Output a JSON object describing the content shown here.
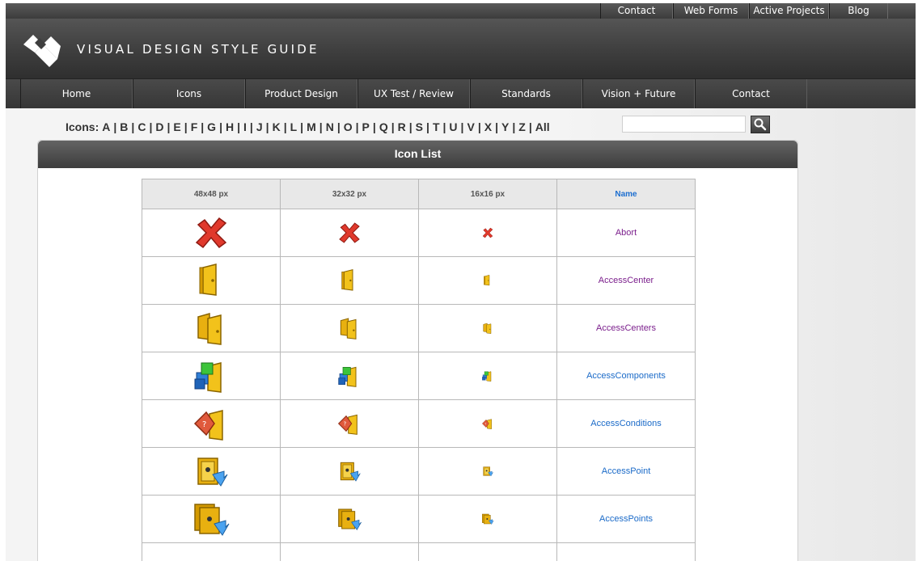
{
  "top_links": [
    {
      "label": "Contact",
      "width": 90
    },
    {
      "label": "Web Forms",
      "width": 94
    },
    {
      "label": "Active Projects",
      "width": 99
    },
    {
      "label": "Blog",
      "width": 73
    }
  ],
  "brand": "VISUAL DESIGN STYLE GUIDE",
  "nav": [
    "Home",
    "Icons",
    "Product Design",
    "UX Test / Review",
    "Standards",
    "Vision + Future",
    "Contact"
  ],
  "filter": {
    "label": "Icons:",
    "letters": [
      "A",
      "B",
      "C",
      "D",
      "E",
      "F",
      "G",
      "H",
      "I",
      "J",
      "K",
      "L",
      "M",
      "N",
      "O",
      "P",
      "Q",
      "R",
      "S",
      "T",
      "U",
      "V",
      "X",
      "Y",
      "Z",
      "All"
    ],
    "search_value": ""
  },
  "panel_title": "Icon List",
  "table": {
    "headers": [
      "48x48 px",
      "32x32 px",
      "16x16 px",
      "Name"
    ],
    "rows": [
      {
        "name": "Abort",
        "icon": "abort-icon",
        "visited": true
      },
      {
        "name": "AccessCenter",
        "icon": "access-center-icon",
        "visited": true
      },
      {
        "name": "AccessCenters",
        "icon": "access-centers-icon",
        "visited": true
      },
      {
        "name": "AccessComponents",
        "icon": "access-components-icon",
        "visited": false
      },
      {
        "name": "AccessConditions",
        "icon": "access-conditions-icon",
        "visited": false
      },
      {
        "name": "AccessPoint",
        "icon": "access-point-icon",
        "visited": false
      },
      {
        "name": "AccessPoints",
        "icon": "access-points-icon",
        "visited": false
      },
      {
        "name": "",
        "icon": "access-partial-icon",
        "visited": false
      }
    ]
  },
  "colors": {
    "link": "#1a6ac8",
    "visited_link": "#7b1f8c",
    "header_dark": "#3e3e3e"
  }
}
